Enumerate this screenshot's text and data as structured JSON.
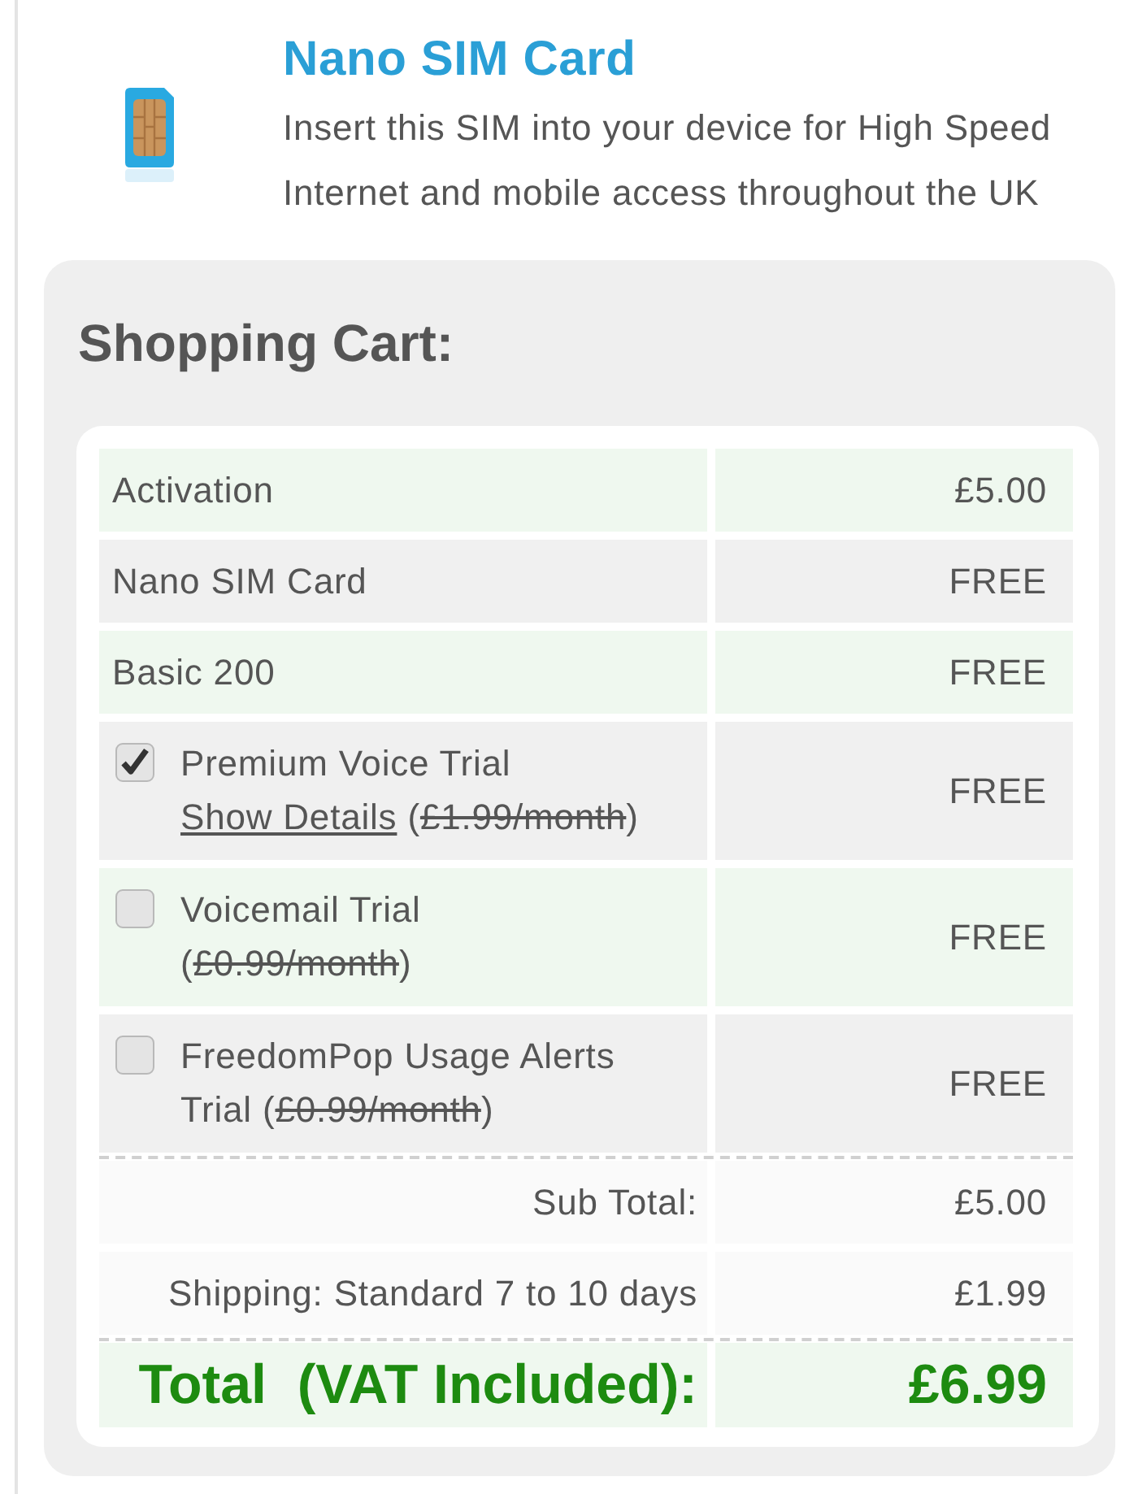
{
  "product": {
    "title": "Nano SIM Card",
    "description": "Insert this SIM into your device for High Speed Internet and mobile access throughout the UK"
  },
  "cart": {
    "title": "Shopping Cart:",
    "items": [
      {
        "kind": "plain",
        "label": "Activation",
        "price": "£5.00"
      },
      {
        "kind": "plain",
        "label": "Nano SIM Card",
        "price": "FREE"
      },
      {
        "kind": "plain",
        "label": "Basic 200",
        "price": "FREE"
      },
      {
        "kind": "option",
        "checked": true,
        "label": "Premium Voice Trial",
        "link": "Show Details",
        "price_note": [
          {
            "text": "(",
            "struck": false
          },
          {
            "text": "£1.99/month",
            "struck": true
          },
          {
            "text": ")",
            "struck": false
          }
        ],
        "price": "FREE"
      },
      {
        "kind": "option",
        "checked": false,
        "label": "Voicemail Trial",
        "price_note": [
          {
            "text": "(",
            "struck": false
          },
          {
            "text": "£0.99/month",
            "struck": true
          },
          {
            "text": ")",
            "struck": false
          }
        ],
        "price": "FREE"
      },
      {
        "kind": "option",
        "checked": false,
        "label": "FreedomPop Usage Alerts Trial",
        "price_note": [
          {
            "text": "(",
            "struck": false
          },
          {
            "text": "£0.99/month",
            "struck": true
          },
          {
            "text": ")",
            "struck": false
          }
        ],
        "price": "FREE"
      }
    ],
    "summary": [
      {
        "kind": "subtotal",
        "label": "Sub Total:",
        "value": "£5.00"
      },
      {
        "kind": "shipping",
        "label": "Shipping: Standard 7 to 10 days",
        "value": "£1.99"
      },
      {
        "kind": "total",
        "label": "Total  (VAT Included):",
        "value": "£6.99"
      }
    ]
  }
}
